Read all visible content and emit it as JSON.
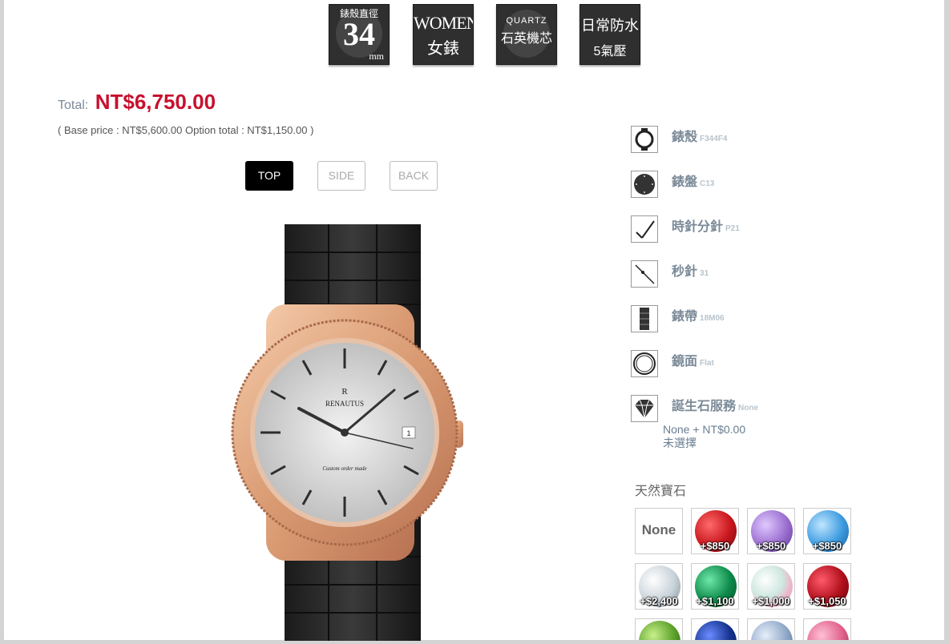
{
  "badges": {
    "case_size": {
      "top": "錶殼直徑",
      "value": "34",
      "unit": "mm"
    },
    "gender": {
      "line1": "WOMEN",
      "line2": "女錶"
    },
    "movement": {
      "line1": "QUARTZ",
      "line2": "石英機芯"
    },
    "water": {
      "line1": "日常防水",
      "line2": "5氣壓"
    }
  },
  "pricing": {
    "total_label": "Total:",
    "total_value": "NT$6,750.00",
    "breakdown": "( Base price : NT$5,600.00 Option total : NT$1,150.00 )"
  },
  "views": {
    "top": "TOP",
    "side": "SIDE",
    "back": "BACK",
    "selected": "TOP"
  },
  "watch": {
    "brand": "RENAUTUS",
    "tagline": "Custom order made"
  },
  "options": [
    {
      "name": "錶殼",
      "code": "F344F4",
      "icon": "case-icon"
    },
    {
      "name": "錶盤",
      "code": "C13",
      "icon": "dial-icon"
    },
    {
      "name": "時針分針",
      "code": "P21",
      "icon": "hands-icon"
    },
    {
      "name": "秒針",
      "code": "31",
      "icon": "second-hand-icon"
    },
    {
      "name": "錶帶",
      "code": "18M06",
      "icon": "strap-icon"
    },
    {
      "name": "鏡面",
      "code": "Flat",
      "icon": "glass-icon"
    },
    {
      "name": "誕生石服務",
      "code": "None",
      "icon": "diamond-icon"
    }
  ],
  "birthstone": {
    "selection_line1": "None + NT$0.00",
    "selection_line2": "未選擇",
    "section_title": "天然寶石",
    "gems": [
      {
        "label": "None",
        "price": "",
        "color": "#ffffff"
      },
      {
        "label": "ruby",
        "price": "+$850",
        "color": "#c8161d"
      },
      {
        "label": "amethyst",
        "price": "+$850",
        "color": "#9b6fd0"
      },
      {
        "label": "blue-topaz",
        "price": "+$850",
        "color": "#3d9be0"
      },
      {
        "label": "diamond",
        "price": "+$2,400",
        "color": "#c9d3da"
      },
      {
        "label": "emerald",
        "price": "+$1,100",
        "color": "#0d8a4a"
      },
      {
        "label": "opal",
        "price": "+$1,000",
        "color": "#cfe7e0"
      },
      {
        "label": "garnet",
        "price": "+$1,050",
        "color": "#b0101c"
      },
      {
        "label": "peridot",
        "price": "",
        "color": "#5aa02a"
      },
      {
        "label": "sapphire",
        "price": "",
        "color": "#13318c"
      },
      {
        "label": "aquamarine",
        "price": "",
        "color": "#8fa8c8"
      },
      {
        "label": "pink-tourmaline",
        "price": "",
        "color": "#e0608a"
      }
    ]
  },
  "colors": {
    "accent_price": "#c8102e",
    "option_text": "#7b8a98"
  }
}
